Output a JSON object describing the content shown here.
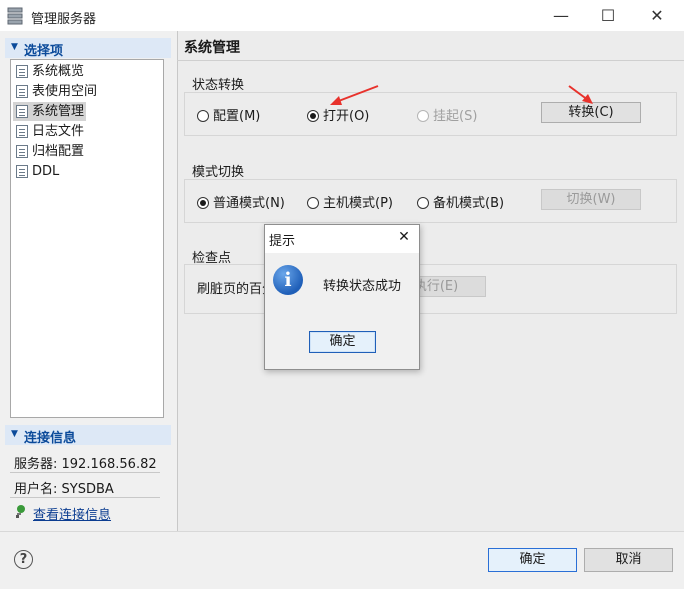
{
  "window": {
    "title": "管理服务器",
    "minimize": "—",
    "maximize": "☐",
    "close": "✕"
  },
  "sidebar": {
    "section1": "选择项",
    "items": [
      {
        "label": "系统概览"
      },
      {
        "label": "表使用空间"
      },
      {
        "label": "系统管理"
      },
      {
        "label": "日志文件"
      },
      {
        "label": "归档配置"
      },
      {
        "label": "DDL"
      }
    ],
    "section2": "连接信息",
    "server": "服务器: 192.168.56.82",
    "username": "用户名: SYSDBA",
    "view_link": "查看连接信息"
  },
  "panel": {
    "title": "系统管理",
    "state_group": {
      "label": "状态转换",
      "options": [
        "配置(M)",
        "打开(O)",
        "挂起(S)"
      ],
      "selected": "打开(O)",
      "button": "转换(C)"
    },
    "mode_group": {
      "label": "模式切换",
      "options": [
        "普通模式(N)",
        "主机模式(P)",
        "备机模式(B)"
      ],
      "selected": "普通模式(N)",
      "button": "切换(W)"
    },
    "checkpoint_group": {
      "label": "检查点",
      "field_label": "刷脏页的百分",
      "button": "执行(E)"
    }
  },
  "footer": {
    "help": "?",
    "ok": "确定",
    "cancel": "取消"
  },
  "dialog": {
    "title": "提示",
    "close": "✕",
    "icon": "i",
    "message": "转换状态成功",
    "ok": "确定"
  },
  "colors": {
    "accent": "#0b4a9a",
    "arrow": "#e8322c",
    "focus_border": "#2a6fd6"
  }
}
